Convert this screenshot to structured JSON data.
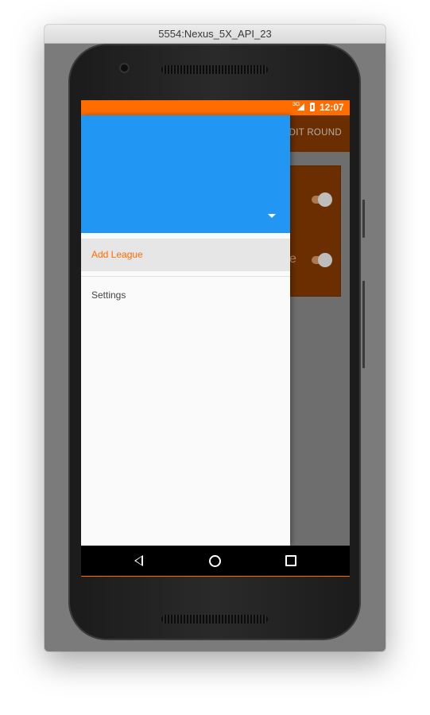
{
  "window": {
    "title": "5554:Nexus_5X_API_23"
  },
  "status_bar": {
    "network": "3G",
    "time": "12:07",
    "color": "#ff6d00"
  },
  "app_bar": {
    "action_label": "EDIT ROUND",
    "color": "#6b2e00"
  },
  "background_content": {
    "partial_text": "e",
    "toggles": [
      "on",
      "on"
    ]
  },
  "drawer": {
    "header_color": "#2196f3",
    "dropdown_icon": "triangle-down-icon",
    "items": [
      {
        "label": "Add League",
        "selected": true,
        "color": "#ff6d00"
      },
      {
        "label": "Settings",
        "selected": false
      }
    ]
  },
  "nav_bar": {
    "icons": [
      "back-icon",
      "home-icon",
      "recents-icon"
    ]
  }
}
